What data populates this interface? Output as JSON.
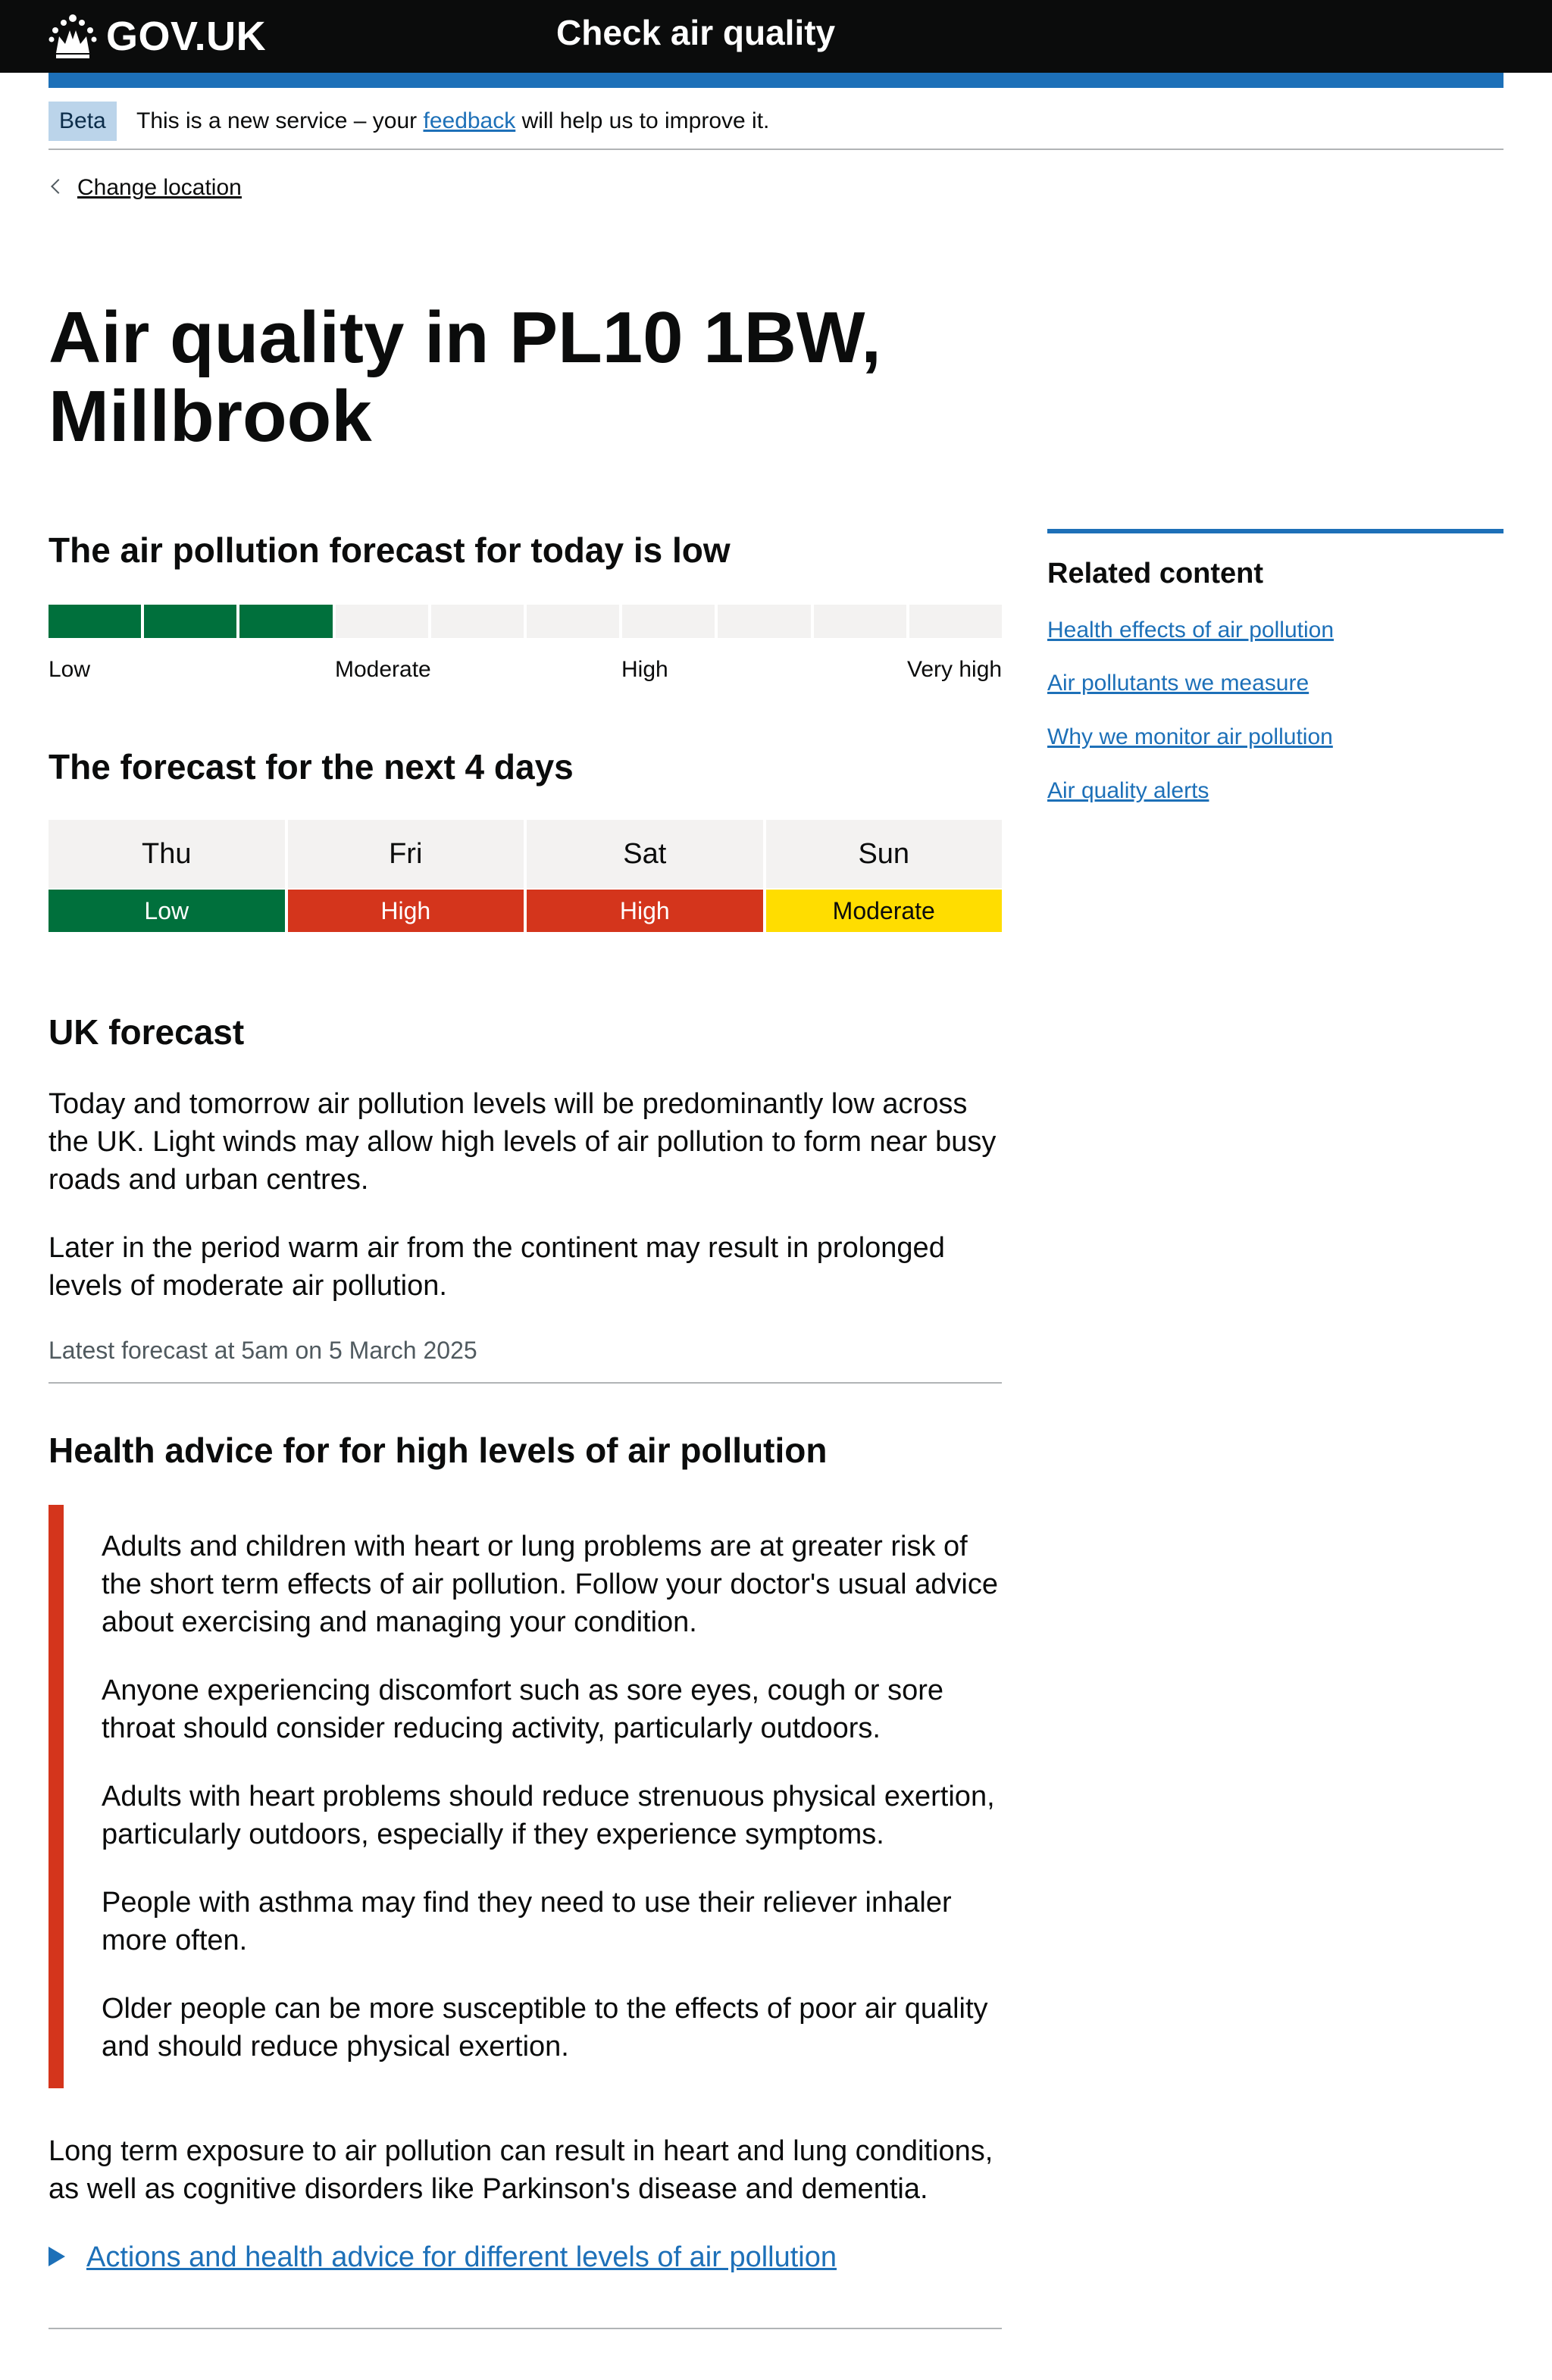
{
  "header": {
    "logo_text": "GOV.UK",
    "service_name": "Check air quality"
  },
  "phase_banner": {
    "tag": "Beta",
    "text_before": "This is a new service – your ",
    "link": "feedback",
    "text_after": " will help us to improve it."
  },
  "back_link": "Change location",
  "title": "Air quality in PL10 1BW, Millbrook",
  "today": {
    "heading": "The air pollution forecast for today is low",
    "meter": {
      "level": 3,
      "max": 10,
      "labels": [
        "Low",
        "Moderate",
        "High",
        "Very high"
      ],
      "active_color": "#00703c",
      "inactive_color": "#f3f2f1"
    }
  },
  "next_days": {
    "heading": "The forecast for the next 4 days",
    "days": [
      {
        "name": "Thu",
        "level": "Low",
        "color": "#00703c"
      },
      {
        "name": "Fri",
        "level": "High",
        "color": "#d4351c"
      },
      {
        "name": "Sat",
        "level": "High",
        "color": "#d4351c"
      },
      {
        "name": "Sun",
        "level": "Moderate",
        "color": "#ffdd00"
      }
    ]
  },
  "uk_forecast": {
    "heading": "UK forecast",
    "paragraphs": [
      "Today and tomorrow air pollution levels will be predominantly low across the UK. Light winds may allow high levels of air pollution to form near busy roads and urban centres.",
      "Later in the period warm air from the continent may result in prolonged levels of moderate air pollution."
    ],
    "updated": "Latest forecast at 5am on 5 March 2025"
  },
  "health": {
    "heading": "Health advice for for high levels of air pollution",
    "inset_color": "#d4351c",
    "advice": [
      "Adults and children with heart or lung problems are at greater risk of the short term effects of air pollution. Follow your doctor's usual advice about exercising and managing your condition.",
      "Anyone experiencing discomfort such as sore eyes, cough or sore throat should consider reducing activity, particularly outdoors.",
      "Adults with heart problems should reduce strenuous physical exertion, particularly outdoors, especially if they experience symptoms.",
      "People with asthma may find they need to use their reliever inhaler more often.",
      "Older people can be more susceptible to the effects of poor air quality and should reduce physical exertion."
    ],
    "long_term": "Long term exposure to air pollution can result in heart and lung conditions, as well as cognitive disorders like Parkinson's disease and dementia.",
    "details_summary": "Actions and health advice for different levels of air pollution"
  },
  "related": {
    "title": "Related content",
    "links": [
      "Health effects of air pollution",
      "Air pollutants we measure",
      "Why we monitor air pollution",
      "Air quality alerts"
    ]
  },
  "colors": {
    "header_bg": "#0b0c0c",
    "accent_blue": "#1d70b8",
    "text": "#0b0c0c",
    "secondary_text": "#505a5f",
    "border": "#b1b4b6",
    "beta_tag_bg": "#bbd4ea"
  },
  "icons": {
    "logo": "crown-icon",
    "back": "chevron-left-icon",
    "details": "triangle-right-icon"
  }
}
